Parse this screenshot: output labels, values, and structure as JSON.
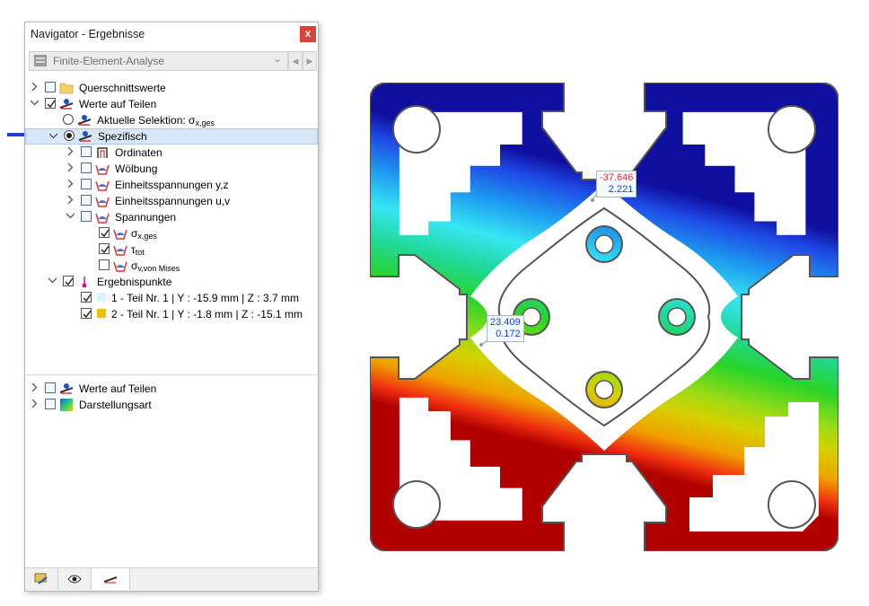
{
  "window": {
    "title": "Navigator - Ergebnisse",
    "close": "x"
  },
  "combo": {
    "value": "Finite-Element-Analyse"
  },
  "tree": {
    "querschnittswerte": "Querschnittswerte",
    "werte_auf_teilen": "Werte auf Teilen",
    "aktuelle_selektion": "Aktuelle Selektion: σ",
    "aktuelle_selektion_sub": "x,ges",
    "spezifisch": "Spezifisch",
    "ordinaten": "Ordinaten",
    "woelbung": "Wölbung",
    "einheits_yz": "Einheitsspannungen y,z",
    "einheits_uv": "Einheitsspannungen u,v",
    "spannungen": "Spannungen",
    "sigma_x": "σ",
    "sigma_x_sub": "x,ges",
    "tau": "τ",
    "tau_sub": "tot",
    "sigma_v": "σ",
    "sigma_v_sub": "v,von Mises",
    "ergebnispunkte": "Ergebnispunkte",
    "punkt1": "1 - Teil Nr. 1 | Y : -15.9 mm | Z : 3.7 mm",
    "punkt2": "2 - Teil Nr. 1 | Y : -1.8 mm | Z : -15.1 mm",
    "werte_auf_teilen_2": "Werte auf Teilen",
    "darstellungsart": "Darstellungsart"
  },
  "colors": {
    "point1": "#d6f6fb",
    "point2": "#f0bf00",
    "selection": "#d8e7f8",
    "arrow": "#1f3fd6"
  },
  "diagram": {
    "label1": {
      "line1": "-37.646",
      "line2": "2.221",
      "color1": "#e03030",
      "color2": "#1a3fc8"
    },
    "label2": {
      "line1": "23.409",
      "line2": "0.172",
      "color1": "#1a3fc8",
      "color2": "#1a3fc8"
    }
  }
}
